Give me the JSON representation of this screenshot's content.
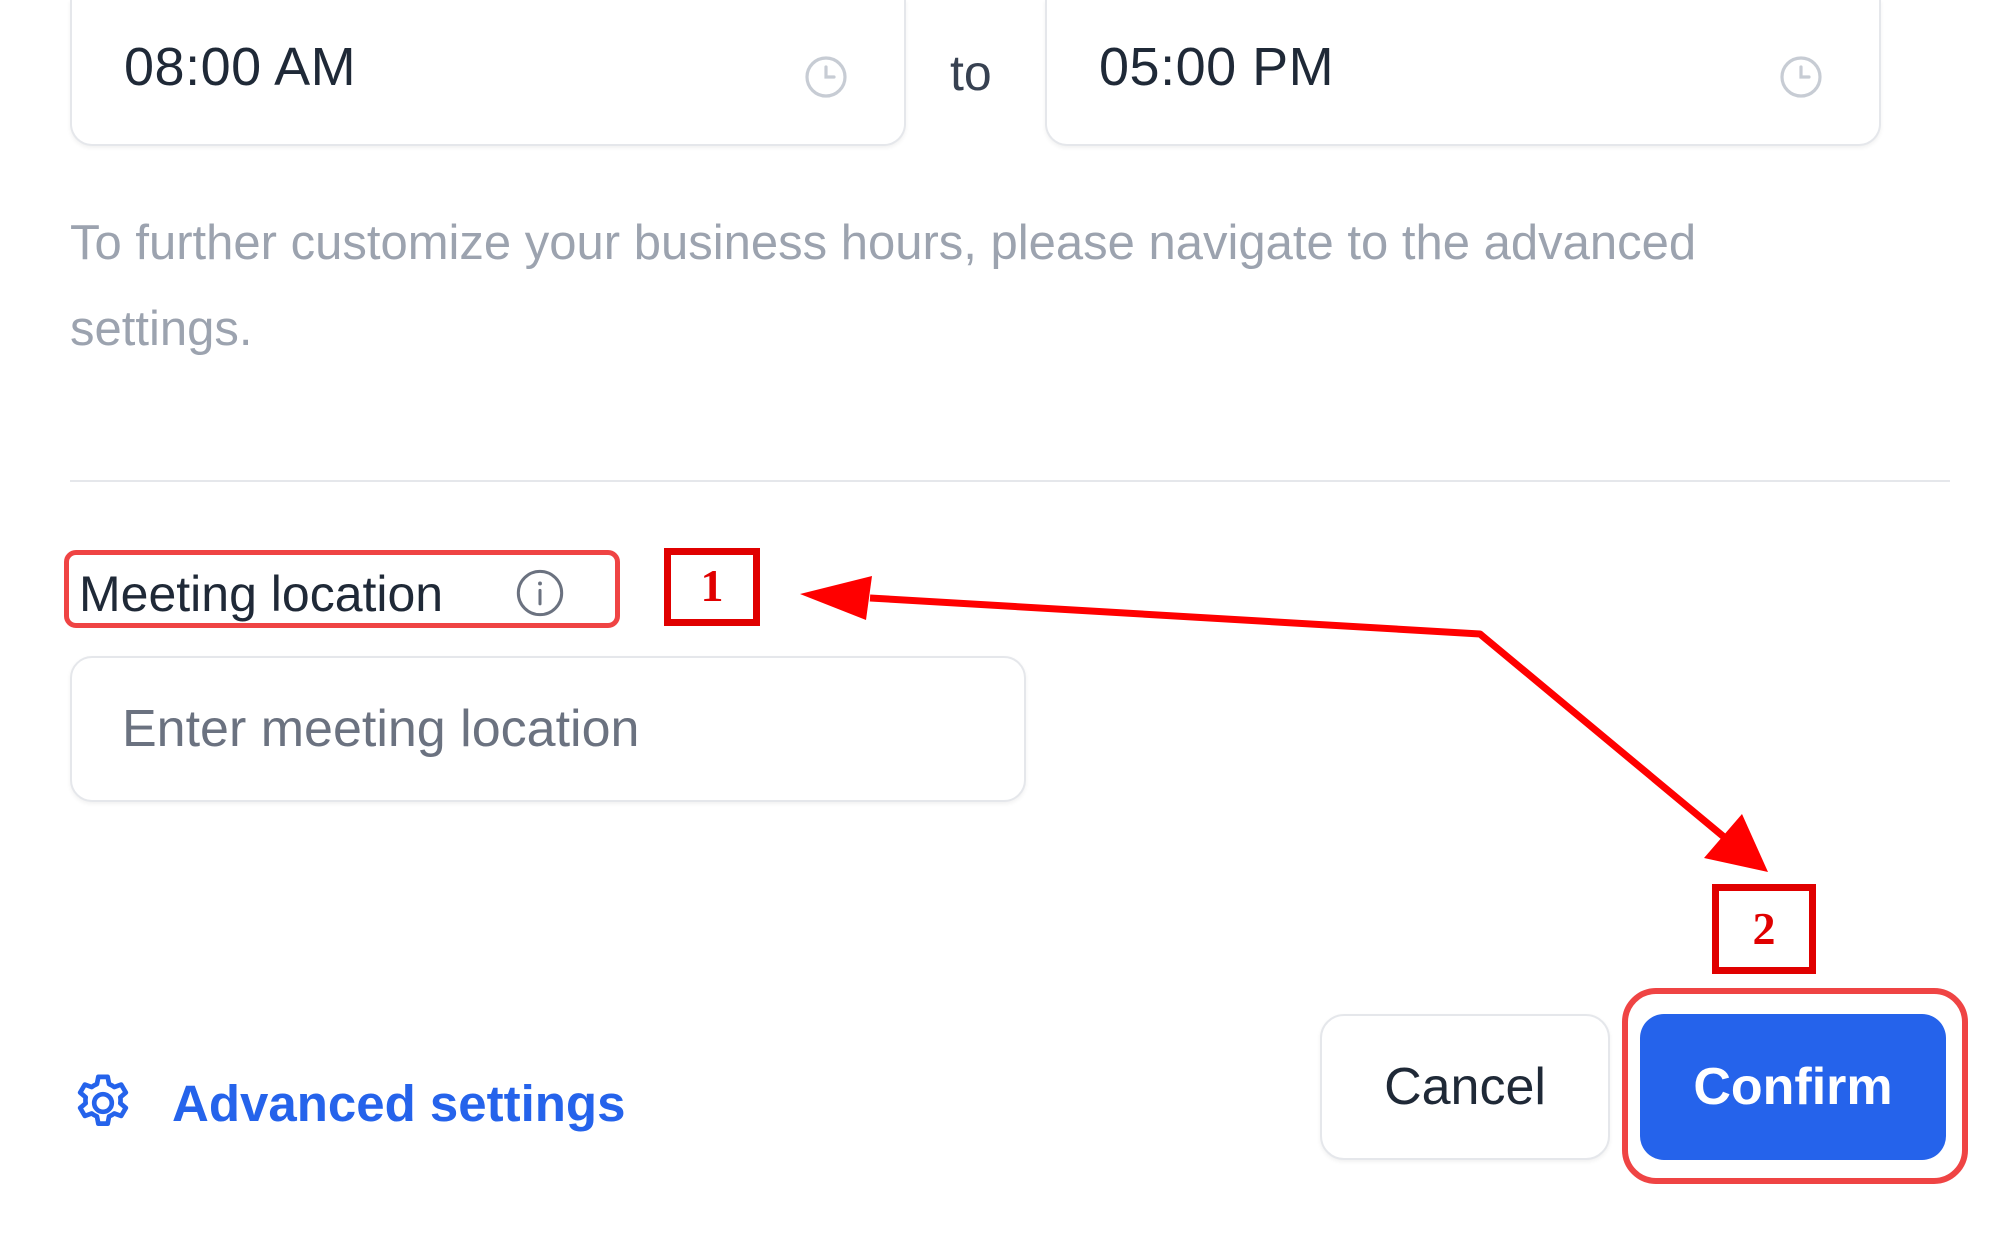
{
  "business_hours": {
    "start_time": "08:00 AM",
    "separator": "to",
    "end_time": "05:00 PM",
    "help_text": "To further customize your business hours, please navigate to the advanced settings."
  },
  "meeting_location": {
    "label": "Meeting location",
    "placeholder": "Enter meeting location",
    "value": ""
  },
  "footer": {
    "advanced_settings_label": "Advanced settings",
    "cancel_label": "Cancel",
    "confirm_label": "Confirm"
  },
  "annotations": {
    "step_1": "1",
    "step_2": "2",
    "color": "#e00000"
  },
  "colors": {
    "accent": "#2563eb",
    "highlight": "#ef4444",
    "muted_text": "#9ca3af"
  },
  "icons": [
    "clock-icon",
    "info-icon",
    "gear-icon"
  ]
}
